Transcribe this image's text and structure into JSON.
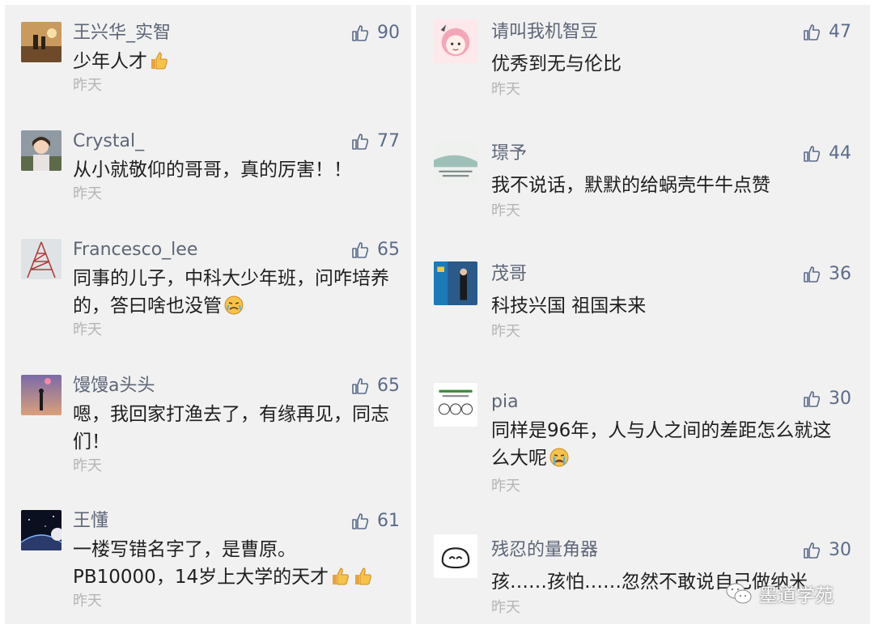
{
  "left_comments": [
    {
      "name": "王兴华_实智",
      "text": "少年人才",
      "time": "昨天",
      "likes": "90"
    },
    {
      "name": "Crystal_",
      "text": "从小就敬仰的哥哥，真的厉害！！",
      "time": "昨天",
      "likes": "77"
    },
    {
      "name": "Francesco_lee",
      "text": "同事的儿子，中科大少年班，问咋培养的，答曰啥也没管",
      "time": "昨天",
      "likes": "65"
    },
    {
      "name": "馒馒a头头",
      "text": "嗯，我回家打渔去了，有缘再见，同志们！",
      "time": "昨天",
      "likes": "65"
    },
    {
      "name": "王懂",
      "text": "一楼写错名字了，是曹原。PB10000，14岁上大学的天才",
      "time": "昨天",
      "likes": "61"
    }
  ],
  "right_comments": [
    {
      "name": "请叫我机智豆",
      "text": "优秀到无与伦比",
      "time": "昨天",
      "likes": "47"
    },
    {
      "name": "璟予",
      "text": "我不说话，默默的给蜗壳牛牛点赞",
      "time": "昨天",
      "likes": "44"
    },
    {
      "name": "茂哥",
      "text": "科技兴国 祖国未来",
      "time": "昨天",
      "likes": "36"
    },
    {
      "name": "pia",
      "text": "同样是96年，人与人之间的差距怎么就这么大呢",
      "time": "昨天",
      "likes": "30"
    },
    {
      "name": "残忍的量角器",
      "text": "孩……孩怕……忽然不敢说自己做纳米",
      "time": "昨天",
      "likes": "30"
    }
  ],
  "watermark": "墨道学苑",
  "colors": {
    "panel_bg": "#f1f1f1",
    "nickname": "#5d6677",
    "like": "#5b6c8a",
    "time": "#b5b5b5"
  }
}
